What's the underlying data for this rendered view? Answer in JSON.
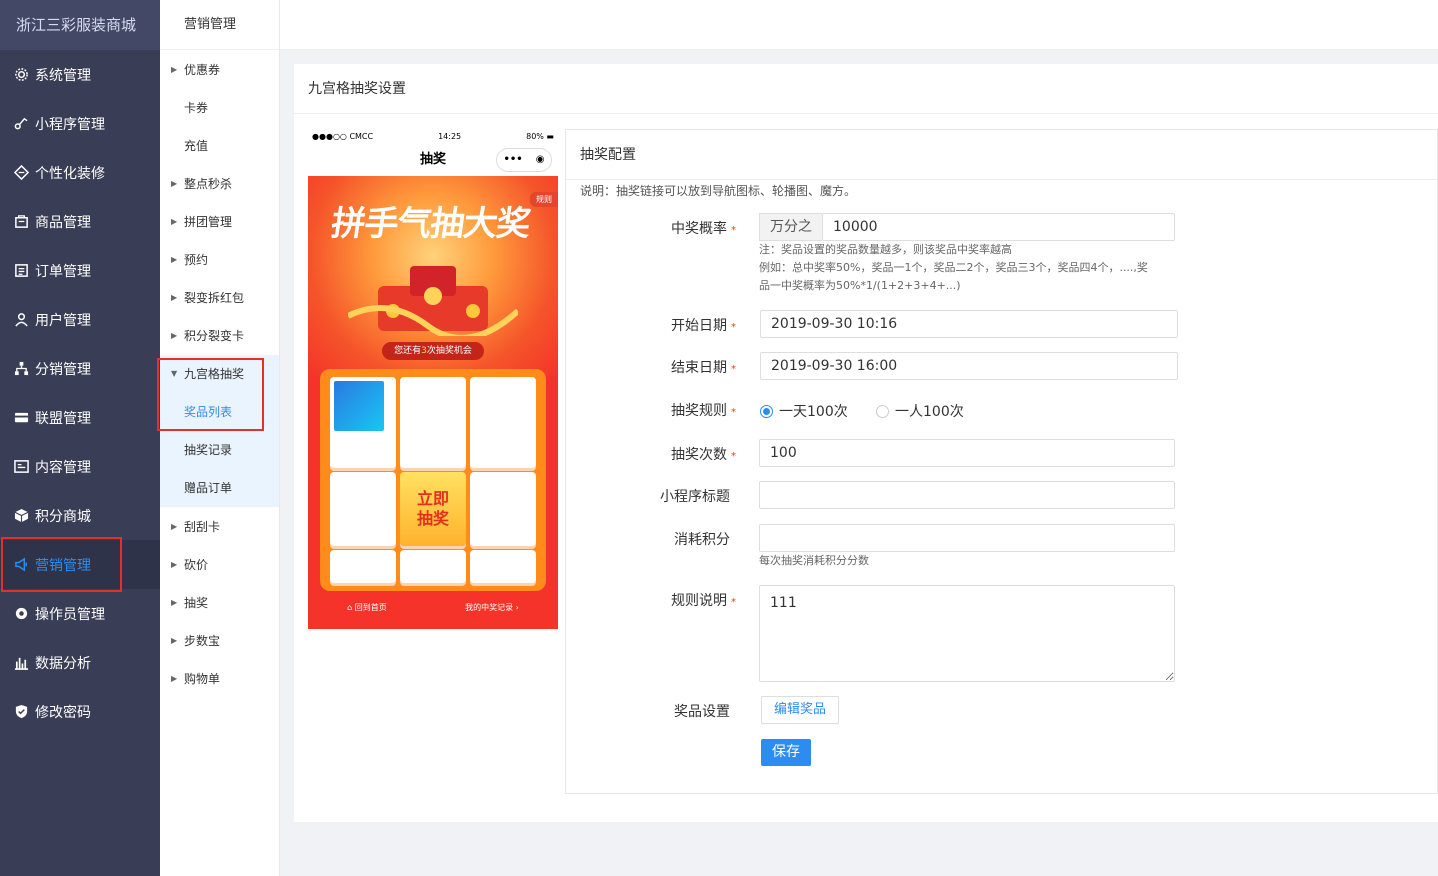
{
  "sidebar": {
    "logo": "浙江三彩服装商城",
    "items": [
      {
        "label": "系统管理",
        "icon": "gear-icon"
      },
      {
        "label": "小程序管理",
        "icon": "link-icon"
      },
      {
        "label": "个性化装修",
        "icon": "diamond-icon"
      },
      {
        "label": "商品管理",
        "icon": "shopping-bag-icon"
      },
      {
        "label": "订单管理",
        "icon": "order-list-icon"
      },
      {
        "label": "用户管理",
        "icon": "user-icon"
      },
      {
        "label": "分销管理",
        "icon": "network-icon"
      },
      {
        "label": "联盟管理",
        "icon": "card-icon"
      },
      {
        "label": "内容管理",
        "icon": "content-icon"
      },
      {
        "label": "积分商城",
        "icon": "box-icon"
      },
      {
        "label": "营销管理",
        "icon": "marketing-icon"
      },
      {
        "label": "操作员管理",
        "icon": "gear-solid-icon"
      },
      {
        "label": "数据分析",
        "icon": "bar-chart-icon"
      },
      {
        "label": "修改密码",
        "icon": "shield-icon"
      }
    ],
    "active_label": "营销管理"
  },
  "subnav": {
    "title": "营销管理",
    "items": [
      "优惠券",
      "卡券",
      "充值",
      "整点秒杀",
      "拼团管理",
      "预约",
      "裂变拆红包",
      "积分裂变卡",
      "九宫格抽奖",
      "奖品列表",
      "抽奖记录",
      "赠品订单",
      "刮刮卡",
      "砍价",
      "抽奖",
      "步数宝",
      "购物单"
    ]
  },
  "panel": {
    "title": "九宫格抽奖设置"
  },
  "phone": {
    "status_left": "●●●○○ CMCC",
    "status_time": "14:25",
    "status_battery": "80%",
    "nav_title": "抽奖",
    "capsule_more": "•••",
    "promo_title": "拼手气抽大奖",
    "rule_badge": "规则",
    "chance_prefix": "您还有",
    "chance_count": "3",
    "chance_suffix": "次抽奖机会",
    "go_button": "立即\n抽奖",
    "footer_home": "回到首页",
    "footer_records": "我的中奖记录"
  },
  "config": {
    "title": "抽奖配置",
    "note": "说明：抽奖链接可以放到导航图标、轮播图、魔方。",
    "probability_label": "中奖概率",
    "probability_prefix": "万分之",
    "probability_value": "10000",
    "probability_hint1": "注：奖品设置的奖品数量越多，则该奖品中奖率越高",
    "probability_hint2": "例如：总中奖率50%，奖品一1个，奖品二2个，奖品三3个，奖品四4个，....,奖",
    "probability_hint3": "品一中奖概率为50%*1/(1+2+3+4+...)",
    "start_label": "开始日期",
    "start_value": "2019-09-30 10:16",
    "end_label": "结束日期",
    "end_value": "2019-09-30 16:00",
    "rule_label": "抽奖规则",
    "rule_option1": "一天100次",
    "rule_option2": "一人100次",
    "count_label": "抽奖次数",
    "count_value": "100",
    "mini_title_label": "小程序标题",
    "mini_title_value": "",
    "points_label": "消耗积分",
    "points_value": "",
    "points_hint": "每次抽奖消耗积分分数",
    "desc_label": "规则说明",
    "desc_value": "111",
    "prize_label": "奖品设置",
    "edit_prize": "编辑奖品",
    "save": "保存",
    "required_mark": "*"
  },
  "colors": {
    "accent": "#2d8cf0",
    "sidebar": "#393d55",
    "highlight_border": "#e2312a"
  }
}
